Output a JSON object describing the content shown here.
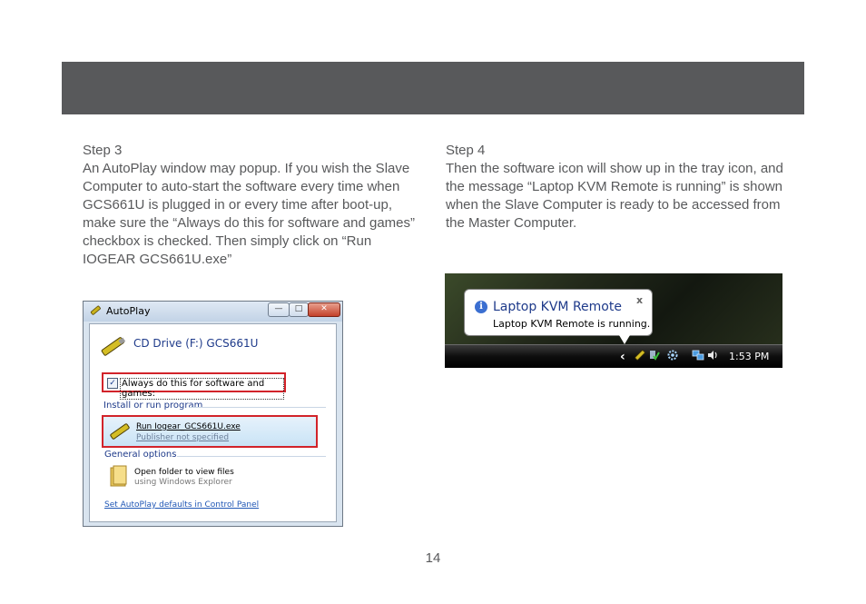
{
  "step3": {
    "heading": "Step 3",
    "body": "An AutoPlay window may popup. If you wish the Slave Computer to auto-start the software every time when GCS661U is plugged in or every time after boot-up, make sure the “Always do this for software and games” checkbox is checked. Then simply click on “Run IOGEAR GCS661U.exe”"
  },
  "step4": {
    "heading": "Step 4",
    "body": "Then the software icon will show up in the tray icon, and the message “Laptop KVM Remote is running” is shown when the Slave Computer is ready to be accessed from the Master Computer."
  },
  "autoplay": {
    "title": "AutoPlay",
    "minimize": "—",
    "maximize": "□",
    "close": "✕",
    "drive": "CD Drive (F:) GCS661U",
    "always_checked": "✓",
    "always_label": "Always do this for software and games:",
    "install_section": "Install or run program",
    "run_name": "Run Iogear_GCS661U.exe",
    "run_publisher": "Publisher not specified",
    "general_section": "General options",
    "folder_title": "Open folder to view files",
    "folder_sub": "using Windows Explorer",
    "defaults_link": "Set AutoPlay defaults in Control Panel"
  },
  "tray": {
    "balloon_title": "Laptop KVM Remote",
    "balloon_message": "Laptop KVM Remote is running.",
    "balloon_close": "x",
    "info_glyph": "i",
    "chevron": "‹",
    "time": "1:53 PM"
  },
  "page_number": "14",
  "colors": {
    "header_bar": "#58595b",
    "text": "#58595b",
    "highlight_border": "#d2232a"
  }
}
